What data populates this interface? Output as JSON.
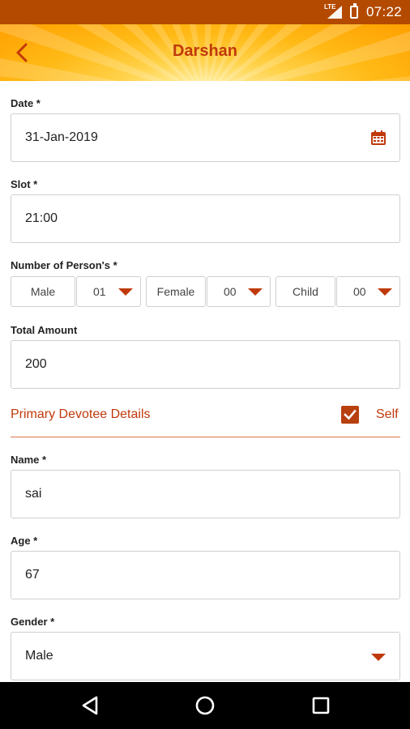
{
  "status_bar": {
    "network": "LTE",
    "time": "07:22"
  },
  "app_bar": {
    "title": "Darshan",
    "back_icon": "chevron-left-icon"
  },
  "form": {
    "date": {
      "label": "Date *",
      "value": "31-Jan-2019",
      "icon": "calendar-icon"
    },
    "slot": {
      "label": "Slot *",
      "value": "21:00"
    },
    "persons": {
      "label": "Number of Person's *",
      "male_label": "Male",
      "male_value": "01",
      "female_label": "Female",
      "female_value": "00",
      "child_label": "Child",
      "child_value": "00"
    },
    "total": {
      "label": "Total Amount",
      "value": "200"
    },
    "primary": {
      "title": "Primary Devotee Details",
      "self_label": "Self",
      "self_checked": true
    },
    "name": {
      "label": "Name *",
      "value": "sai"
    },
    "age": {
      "label": "Age *",
      "value": "67"
    },
    "gender": {
      "label": "Gender *",
      "value": "Male"
    }
  },
  "nav_bar": {
    "back_icon": "triangle-back-icon",
    "home_icon": "circle-home-icon",
    "recents_icon": "square-recents-icon"
  },
  "colors": {
    "accent": "#c0390b",
    "status_bar": "#b34a00",
    "checkbox": "#b8400f"
  }
}
